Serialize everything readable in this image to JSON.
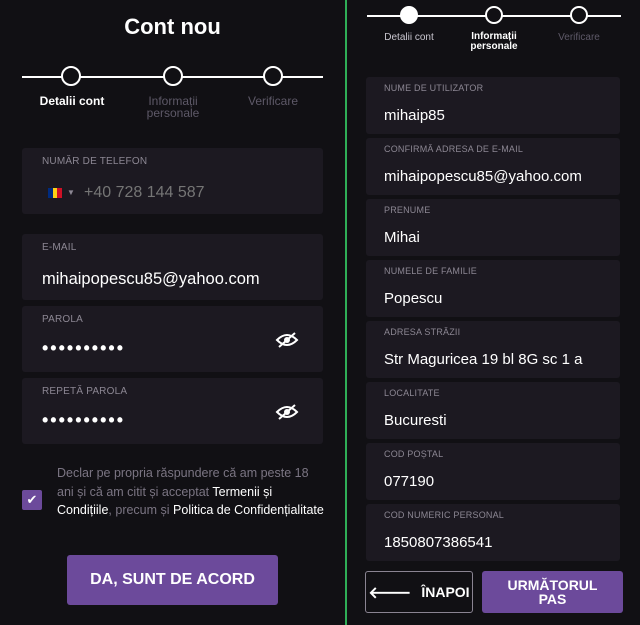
{
  "left": {
    "title": "Cont nou",
    "steps": [
      {
        "label": "Detalii cont",
        "state": "current"
      },
      {
        "label": "Informații personale",
        "state": "future"
      },
      {
        "label": "Verificare",
        "state": "future"
      }
    ],
    "phone": {
      "label": "NUMĂR DE TELEFON",
      "placeholder": "+40 728 144 587",
      "flag_colors": [
        "#002b7f",
        "#fcd116",
        "#ce1126"
      ]
    },
    "email": {
      "label": "E-MAIL",
      "value": "mihaipopescu85@yahoo.com"
    },
    "password": {
      "label": "PAROLA",
      "value": "••••••••••"
    },
    "repeat_password": {
      "label": "REPETĂ PAROLA",
      "value": "••••••••••"
    },
    "consent": {
      "checked": true,
      "text_1": "Declar pe propria răspundere că am peste 18 ani și că am citit și acceptat ",
      "terms_link": "Termenii și Condițiile",
      "text_2": ", precum și ",
      "privacy_link": "Politica de Confidențialitate"
    },
    "agree_button": "DA, SUNT DE ACORD"
  },
  "right": {
    "steps": [
      {
        "label": "Detalii cont",
        "state": "done"
      },
      {
        "label": "Informații personale",
        "state": "current"
      },
      {
        "label": "Verificare",
        "state": "future"
      }
    ],
    "fields": [
      {
        "label": "NUME DE UTILIZATOR",
        "value": "mihaip85"
      },
      {
        "label": "CONFIRMĂ ADRESA DE E-MAIL",
        "value": "mihaipopescu85@yahoo.com"
      },
      {
        "label": "PRENUME",
        "value": "Mihai"
      },
      {
        "label": "NUMELE DE FAMILIE",
        "value": "Popescu"
      },
      {
        "label": "ADRESA STRĂZII",
        "value": "Str Maguricea 19 bl 8G sc 1 a"
      },
      {
        "label": "LOCALITATE",
        "value": "Bucuresti"
      },
      {
        "label": "COD POȘTAL",
        "value": "077190"
      },
      {
        "label": "COD NUMERIC PERSONAL",
        "value": "1850807386541"
      }
    ],
    "back_button": "ÎNAPOI",
    "next_button": "URMĂTORUL PAS"
  },
  "colors": {
    "accent": "#6c4a9b",
    "divider": "#2fae57",
    "field_bg": "#1c1921",
    "page_bg": "#111014"
  }
}
